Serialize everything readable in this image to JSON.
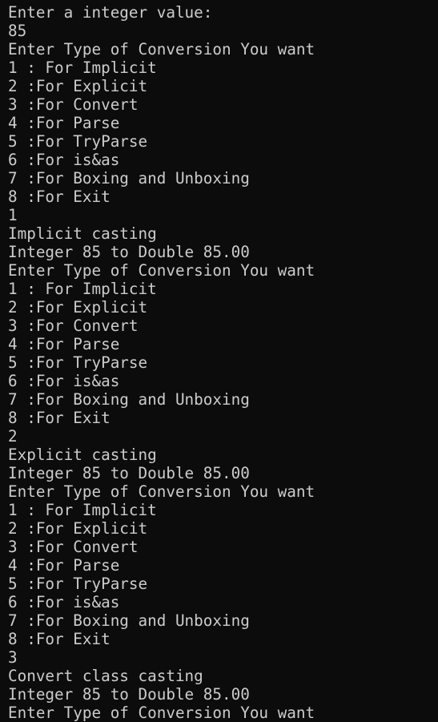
{
  "colors": {
    "background": "#0c0c0c",
    "text": "#cccccc"
  },
  "console": {
    "lines": [
      "Enter a integer value:",
      "85",
      "Enter Type of Conversion You want",
      "1 : For Implicit",
      "2 :For Explicit",
      "3 :For Convert",
      "4 :For Parse",
      "5 :For TryParse",
      "6 :For is&as",
      "7 :For Boxing and Unboxing",
      "8 :For Exit",
      "1",
      "Implicit casting",
      "Integer 85 to Double 85.00",
      "Enter Type of Conversion You want",
      "1 : For Implicit",
      "2 :For Explicit",
      "3 :For Convert",
      "4 :For Parse",
      "5 :For TryParse",
      "6 :For is&as",
      "7 :For Boxing and Unboxing",
      "8 :For Exit",
      "2",
      "Explicit casting",
      "Integer 85 to Double 85.00",
      "Enter Type of Conversion You want",
      "1 : For Implicit",
      "2 :For Explicit",
      "3 :For Convert",
      "4 :For Parse",
      "5 :For TryParse",
      "6 :For is&as",
      "7 :For Boxing and Unboxing",
      "8 :For Exit",
      "3",
      "Convert class casting",
      "Integer 85 to Double 85.00",
      "Enter Type of Conversion You want"
    ]
  }
}
